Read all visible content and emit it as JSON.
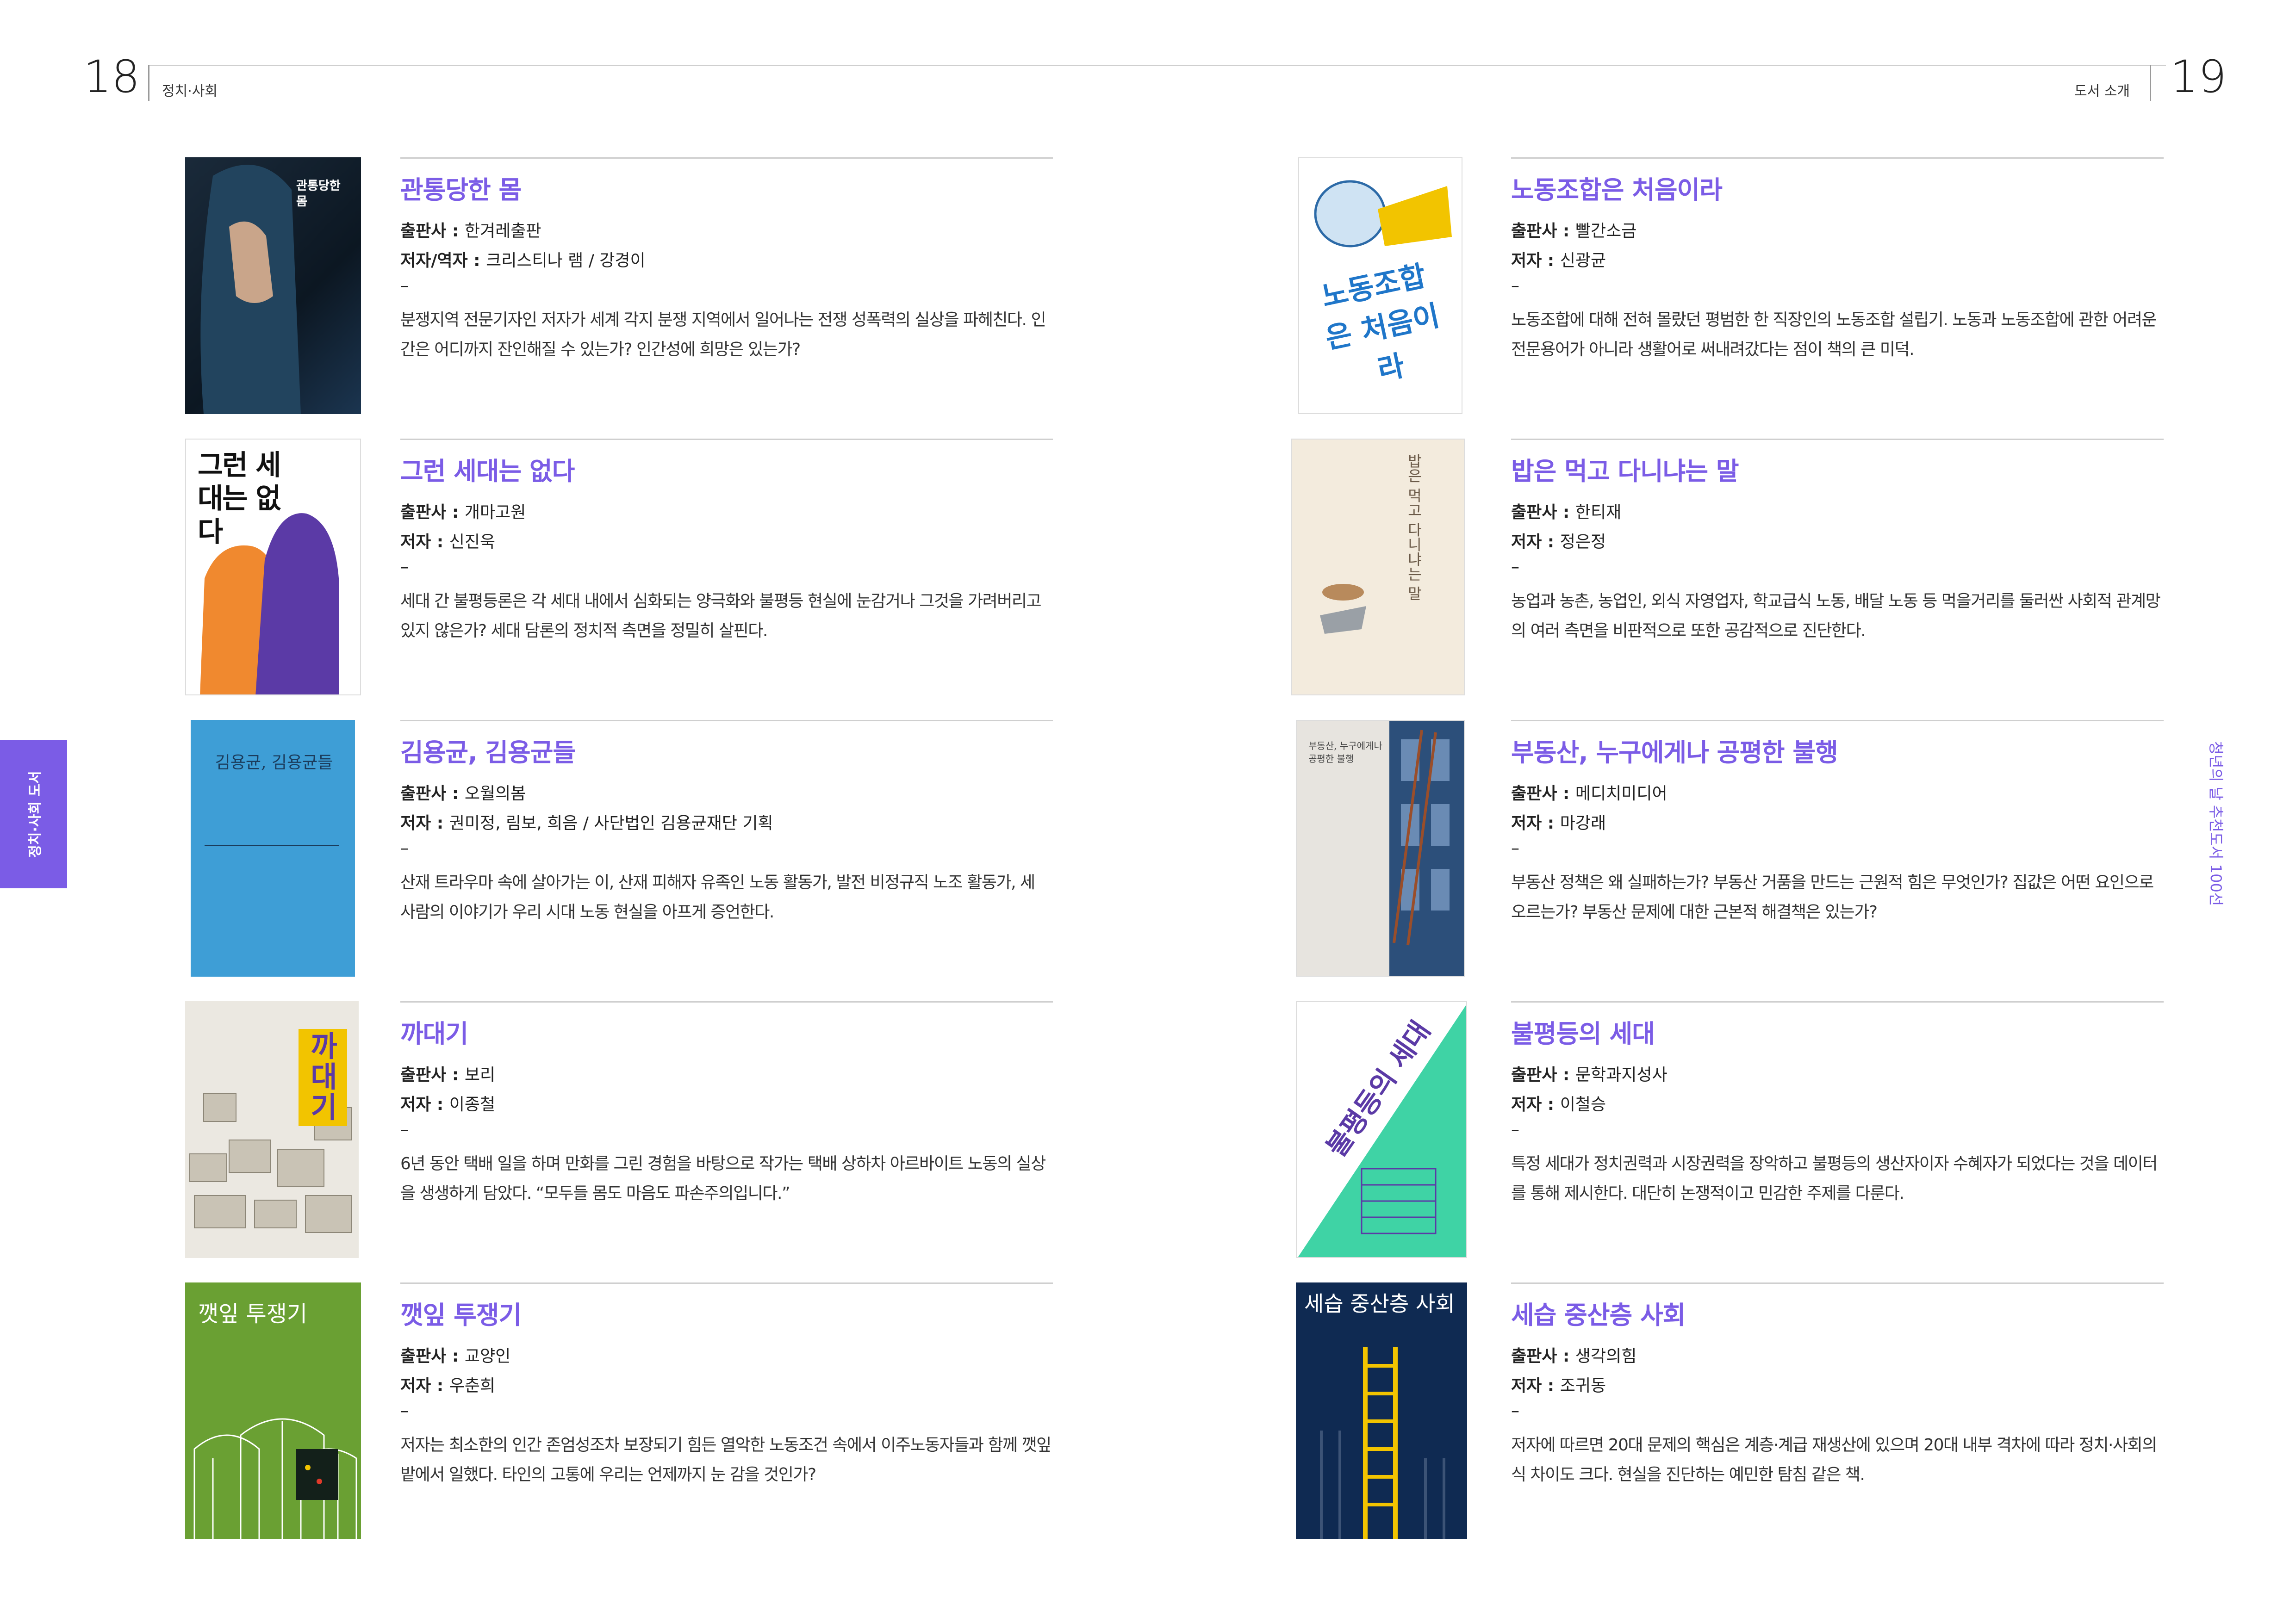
{
  "header": {
    "left_page_number": "18",
    "left_section": "정치·사회",
    "right_section": "도서 소개",
    "right_page_number": "19"
  },
  "side_tab": {
    "label": "정치·사회 도서"
  },
  "side_right": {
    "label": "청년의 날 추천도서 100선"
  },
  "labels": {
    "publisher": "출판사",
    "author": "저자",
    "author_translator": "저자/역자"
  },
  "books_left": [
    {
      "title": "관통당한 몸",
      "publisher": "한겨레출판",
      "author_label": "저자/역자",
      "author": "크리스티나 램 / 강경이",
      "dash": "–",
      "description": "분쟁지역 전문기자인 저자가 세계 각지 분쟁 지역에서 일어나는 전쟁 성폭력의 실상을 파헤친다. 인간은 어디까지 잔인해질 수 있는가? 인간성에 희망은 있는가?",
      "cover_text": "관통당한 몸"
    },
    {
      "title": "그런 세대는 없다",
      "publisher": "개마고원",
      "author_label": "저자",
      "author": "신진욱",
      "dash": "–",
      "description": "세대 간 불평등론은 각 세대 내에서 심화되는 양극화와 불평등 현실에 눈감거나 그것을 가려버리고 있지 않은가? 세대 담론의 정치적 측면을 정밀히 살핀다.",
      "cover_text": "그런 세대는 없다"
    },
    {
      "title": "김용균, 김용균들",
      "publisher": "오월의봄",
      "author_label": "저자",
      "author": "권미정, 림보, 희음 / 사단법인 김용균재단 기획",
      "dash": "–",
      "description": "산재 트라우마 속에 살아가는 이, 산재 피해자 유족인 노동 활동가, 발전 비정규직 노조 활동가, 세 사람의 이야기가 우리 시대 노동 현실을 아프게 증언한다.",
      "cover_text": "김용균, 김용균들"
    },
    {
      "title": "까대기",
      "publisher": "보리",
      "author_label": "저자",
      "author": "이종철",
      "dash": "–",
      "description": "6년 동안 택배 일을 하며 만화를 그린 경험을 바탕으로 작가는 택배 상하차 아르바이트 노동의 실상을 생생하게 담았다. “모두들 몸도 마음도 파손주의입니다.”",
      "cover_text": "까대기"
    },
    {
      "title": "깻잎 투쟁기",
      "publisher": "교양인",
      "author_label": "저자",
      "author": "우춘희",
      "dash": "–",
      "description": "저자는 최소한의 인간 존엄성조차 보장되기 힘든 열악한 노동조건 속에서 이주노동자들과 함께 깻잎밭에서 일했다. 타인의 고통에 우리는 언제까지 눈 감을 것인가?",
      "cover_text": "깻잎 투쟁기"
    }
  ],
  "books_right": [
    {
      "title": "노동조합은 처음이라",
      "publisher": "빨간소금",
      "author_label": "저자",
      "author": "신광균",
      "dash": "–",
      "description": "노동조합에 대해 전혀 몰랐던 평범한 한 직장인의 노동조합 설립기. 노동과 노동조합에 관한 어려운 전문용어가 아니라 생활어로 써내려갔다는 점이 책의 큰 미덕.",
      "cover_text": "노동조합은 처음이라"
    },
    {
      "title": "밥은 먹고 다니냐는 말",
      "publisher": "한티재",
      "author_label": "저자",
      "author": "정은정",
      "dash": "–",
      "description": "농업과 농촌, 농업인, 외식 자영업자, 학교급식 노동, 배달 노동 등 먹을거리를 둘러싼 사회적 관계망의 여러 측면을 비판적으로 또한 공감적으로 진단한다.",
      "cover_text": "밥은 먹고 다니냐는 말"
    },
    {
      "title": "부동산, 누구에게나 공평한 불행",
      "publisher": "메디치미디어",
      "author_label": "저자",
      "author": "마강래",
      "dash": "–",
      "description": "부동산 정책은 왜 실패하는가? 부동산 거품을 만드는 근원적 힘은 무엇인가? 집값은 어떤 요인으로 오르는가? 부동산 문제에 대한 근본적 해결책은 있는가?",
      "cover_text": "부동산, 누구에게나 공평한 불행"
    },
    {
      "title": "불평등의 세대",
      "publisher": "문학과지성사",
      "author_label": "저자",
      "author": "이철승",
      "dash": "–",
      "description": "특정 세대가 정치권력과 시장권력을 장악하고 불평등의 생산자이자 수혜자가 되었다는 것을 데이터를 통해 제시한다. 대단히 논쟁적이고 민감한 주제를 다룬다.",
      "cover_text": "불평등의 세대"
    },
    {
      "title": "세습 중산층 사회",
      "publisher": "생각의힘",
      "author_label": "저자",
      "author": "조귀동",
      "dash": "–",
      "description": "저자에 따르면 20대 문제의 핵심은 계층·계급 재생산에 있으며 20대 내부 격차에 따라 정치·사회의식 차이도 크다. 현실을 진단하는 예민한 탐침 같은 책.",
      "cover_text": "세습 중산층 사회"
    }
  ],
  "colors": {
    "accent": "#7b5ce6",
    "rule": "#cfcfcf",
    "text": "#222222"
  }
}
